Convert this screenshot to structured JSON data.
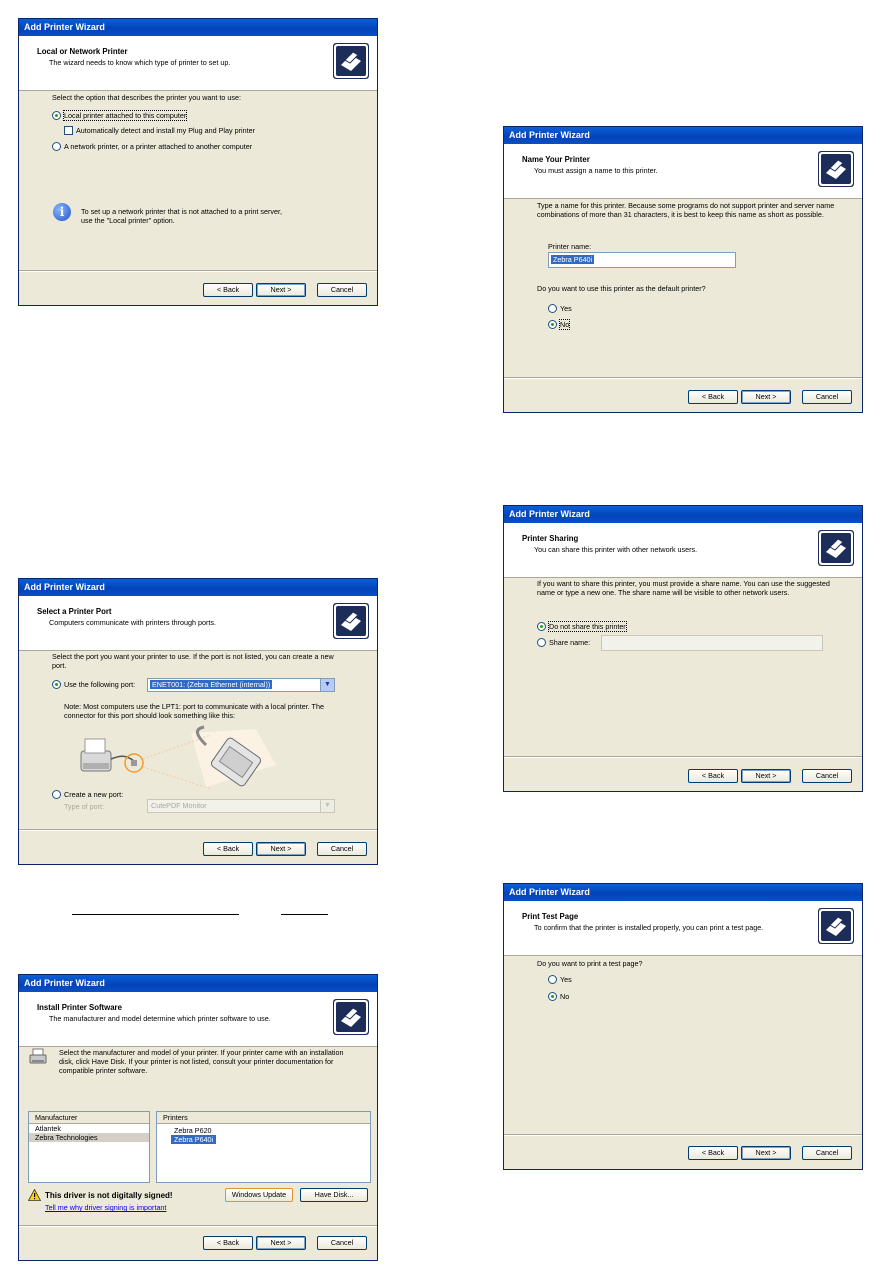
{
  "dialog_title": "Add Printer Wizard",
  "buttons": {
    "back": "< Back",
    "next": "Next >",
    "cancel": "Cancel",
    "windows_update": "Windows Update",
    "have_disk": "Have Disk..."
  },
  "local_network": {
    "title": "Local or Network Printer",
    "subtitle": "The wizard needs to know which type of printer to set up.",
    "prompt": "Select the option that describes the printer you want to use:",
    "option_local": "Local printer attached to this computer",
    "option_pnp": "Automatically detect and install my Plug and Play printer",
    "option_network": "A network printer, or a printer attached to another computer",
    "info_line1": "To set up a network printer that is not attached to a print server,",
    "info_line2": "use the \"Local printer\" option."
  },
  "name_printer": {
    "title": "Name Your Printer",
    "subtitle": "You must assign a name to this printer.",
    "description": "Type a name for this printer. Because some programs do not support printer and server name combinations of more than 31 characters, it is best to keep this name as short as possible.",
    "name_label": "Printer name:",
    "name_value": "Zebra P640i",
    "default_question": "Do you want to use this printer as the default printer?",
    "yes": "Yes",
    "no": "No"
  },
  "printer_port": {
    "title": "Select a Printer Port",
    "subtitle": "Computers communicate with printers through ports.",
    "description": "Select the port you want your printer to use. If the port is not listed, you can create a new port.",
    "use_port_label": "Use the following port:",
    "port_value": "ENET001: (Zebra Ethernet (internal))",
    "note": "Note: Most computers use the LPT1: port to communicate with a local printer. The connector for this port should look something like this:",
    "create_port_label": "Create a new port:",
    "type_label": "Type of port:",
    "type_value": "CutePDF Monitor"
  },
  "printer_sharing": {
    "title": "Printer Sharing",
    "subtitle": "You can share this printer with other network users.",
    "description": "If you want to share this printer, you must provide a share name. You can use the suggested name or type a new one. The share name will be visible to other network users.",
    "do_not_share": "Do not share this printer",
    "share_name": "Share name:"
  },
  "install_software": {
    "title": "Install Printer Software",
    "subtitle": "The manufacturer and model determine which printer software to use.",
    "description": "Select the manufacturer and model of your printer. If your printer came with an installation disk, click Have Disk. If your printer is not listed, consult your printer documentation for compatible printer software.",
    "manufacturer_header": "Manufacturer",
    "manufacturers": [
      "Atlantek",
      "Zebra Technologies"
    ],
    "printers_header": "Printers",
    "printers": [
      "Zebra P620",
      "Zebra P640i"
    ],
    "warning": "This driver is not digitally signed!",
    "signing_link": "Tell me why driver signing is important"
  },
  "test_page": {
    "title": "Print Test Page",
    "subtitle": "To confirm that the printer is installed properly, you can print a test page.",
    "question": "Do you want to print a test page?",
    "yes": "Yes",
    "no": "No"
  }
}
